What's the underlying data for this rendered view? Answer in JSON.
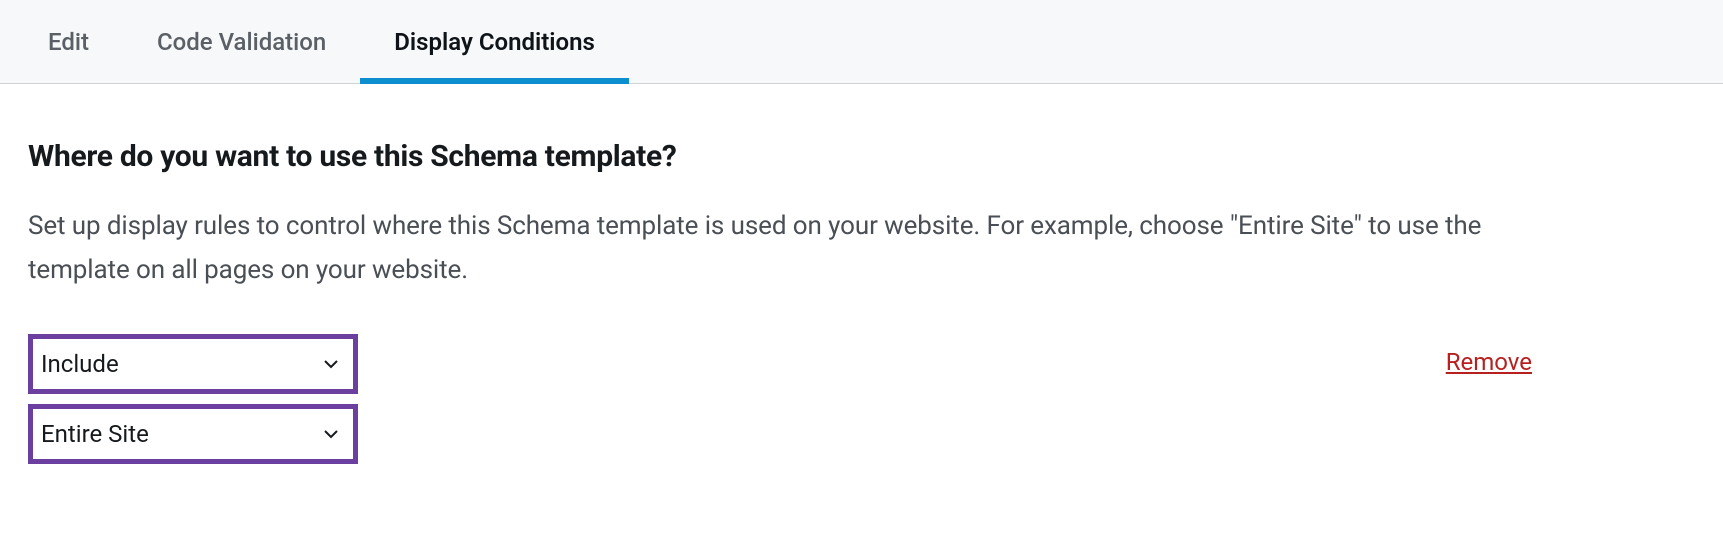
{
  "tabs": {
    "items": [
      {
        "label": "Edit",
        "active": false
      },
      {
        "label": "Code Validation",
        "active": false
      },
      {
        "label": "Display Conditions",
        "active": true
      }
    ]
  },
  "main": {
    "heading": "Where do you want to use this Schema template?",
    "description": "Set up display rules to control where this Schema template is used on your website. For example, choose \"Entire Site\" to use the template on all pages on your website.",
    "rule": {
      "include_select": "Include",
      "scope_select": "Entire Site",
      "remove_label": "Remove"
    }
  }
}
